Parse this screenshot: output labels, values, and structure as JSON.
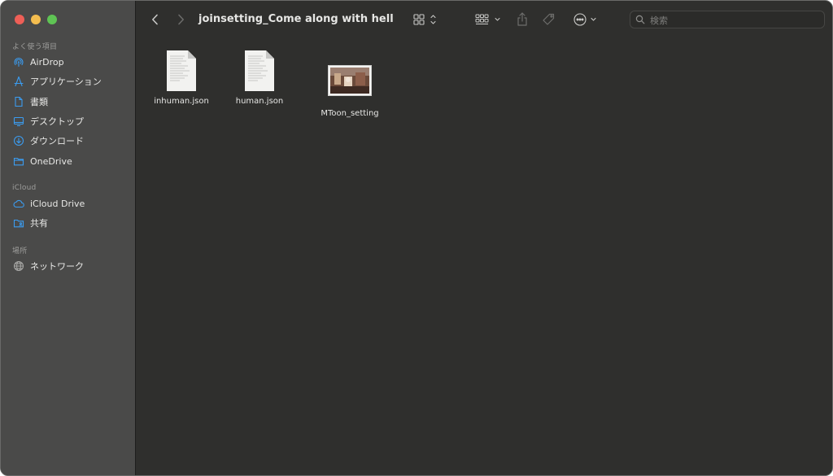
{
  "window": {
    "title": "joinsetting_Come along with hell"
  },
  "sidebar": {
    "sections": [
      {
        "title": "よく使う項目"
      },
      {
        "title": "iCloud"
      },
      {
        "title": "場所"
      }
    ],
    "items": [
      {
        "label": "AirDrop",
        "icon": "airdrop-icon"
      },
      {
        "label": "アプリケーション",
        "icon": "applications-icon"
      },
      {
        "label": "書類",
        "icon": "document-icon"
      },
      {
        "label": "デスクトップ",
        "icon": "desktop-icon"
      },
      {
        "label": "ダウンロード",
        "icon": "download-icon"
      },
      {
        "label": "OneDrive",
        "icon": "folder-icon"
      },
      {
        "label": "iCloud Drive",
        "icon": "cloud-icon"
      },
      {
        "label": "共有",
        "icon": "shared-folder-icon"
      },
      {
        "label": "ネットワーク",
        "icon": "network-globe-icon"
      }
    ]
  },
  "toolbar": {
    "search_placeholder": "検索"
  },
  "files": [
    {
      "name": "inhuman.json",
      "kind": "json"
    },
    {
      "name": "human.json",
      "kind": "json"
    },
    {
      "name": "MToon_setting",
      "kind": "image"
    }
  ],
  "colors": {
    "sidebar_bg": "#4a4a49",
    "content_bg": "#2f2f2d",
    "accent": "#3b9cf0",
    "traffic_red": "#ee5f57",
    "traffic_yellow": "#f4bd4f",
    "traffic_green": "#5fc454"
  }
}
